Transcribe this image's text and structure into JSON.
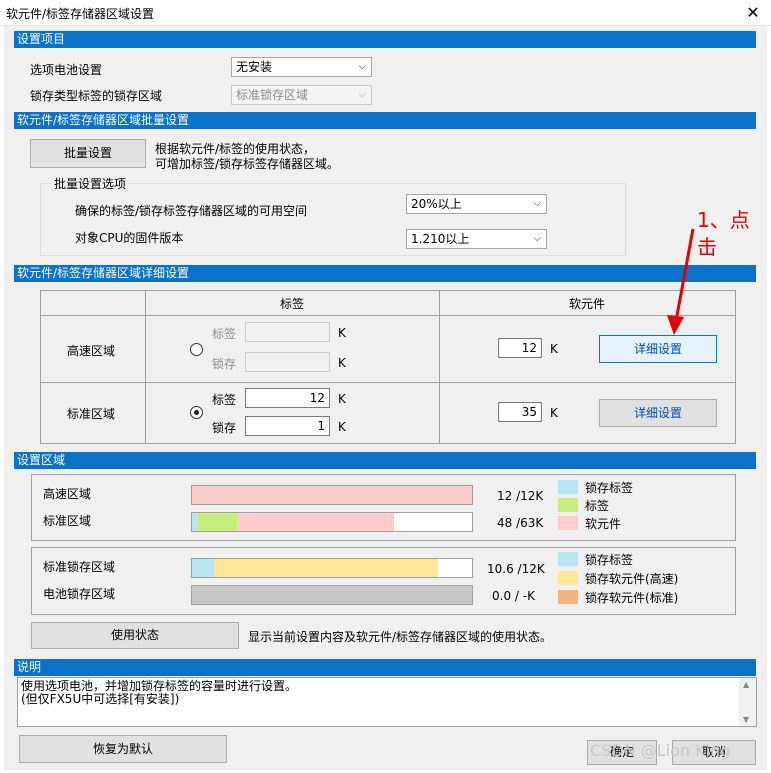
{
  "window": {
    "title": "软元件/标签存储器区域设置",
    "close_glyph": "✕"
  },
  "sec1": {
    "header": "设置项目",
    "battery_label": "选项电池设置",
    "battery_value": "无安装",
    "latch_label": "锁存类型标签的锁存区域",
    "latch_value": "标准锁存区域"
  },
  "sec2": {
    "header": "软元件/标签存储器区域批量设置",
    "batch_button": "批量设置",
    "desc_line1": "根据软元件/标签的使用状态，",
    "desc_line2": "可增加标签/锁存标签存储器区域。",
    "options_title": "批量设置选项",
    "space_label": "确保的标签/锁存标签存储器区域的可用空间",
    "space_value": "20%以上",
    "fw_label": "对象CPU的固件版本",
    "fw_value": "1.210以上"
  },
  "sec3": {
    "header": "软元件/标签存储器区域详细设置",
    "col_label": "标签",
    "col_device": "软元件",
    "high_speed": {
      "name": "高速区域",
      "label_text": "标签",
      "latch_text": "锁存",
      "label_value": "",
      "latch_value": "",
      "unit": "K",
      "device_value": "12",
      "detail_button": "详细设置",
      "selected": false
    },
    "standard": {
      "name": "标准区域",
      "label_text": "标签",
      "latch_text": "锁存",
      "label_value": "12",
      "latch_value": "1",
      "unit": "K",
      "device_value": "35",
      "detail_button": "详细设置",
      "selected": true
    }
  },
  "sec4": {
    "header": "设置区域",
    "high_speed_label": "高速区域",
    "high_speed_usage": "12 /12K",
    "standard_label": "标准区域",
    "standard_usage": "48 /63K",
    "legend1": [
      "锁存标签",
      "标签",
      "软元件"
    ],
    "std_latch_label": "标准锁存区域",
    "std_latch_usage": "10.6 /12K",
    "battery_latch_label": "电池锁存区域",
    "battery_latch_usage": "0.0 / -K",
    "legend2": [
      "锁存标签",
      "锁存软元件(高速)",
      "锁存软元件(标准)"
    ],
    "usage_button": "使用状态",
    "usage_desc": "显示当前设置内容及软元件/标签存储器区域的使用状态。",
    "standard_bar": {
      "latch_label": 0.02,
      "label": 0.14,
      "device": 0.56
    },
    "std_latch_bar": {
      "latch_label": 0.08,
      "latch_device_high": 0.8
    }
  },
  "sec5": {
    "header": "说明",
    "line1": "使用选项电池，并增加锁存标签的容量时进行设置。",
    "line2": "(但仅FX5U中可选择[有安装])"
  },
  "footer": {
    "restore_button": "恢复为默认",
    "ok_button": "确定",
    "cancel_button": "取消"
  },
  "annotation": {
    "line1": "1、点",
    "line2": "击"
  },
  "watermark": "CSDN @Lion King",
  "colors": {
    "section_bar": "#0a72c8",
    "latch_label": "#b7e6f6",
    "label": "#c7ee7c",
    "device": "#ffcccd",
    "latch_device_high": "#ffe79a",
    "latch_device_std": "#f5b27c",
    "battery_bar": "#c8c8c8",
    "annotation": "#e60000"
  }
}
